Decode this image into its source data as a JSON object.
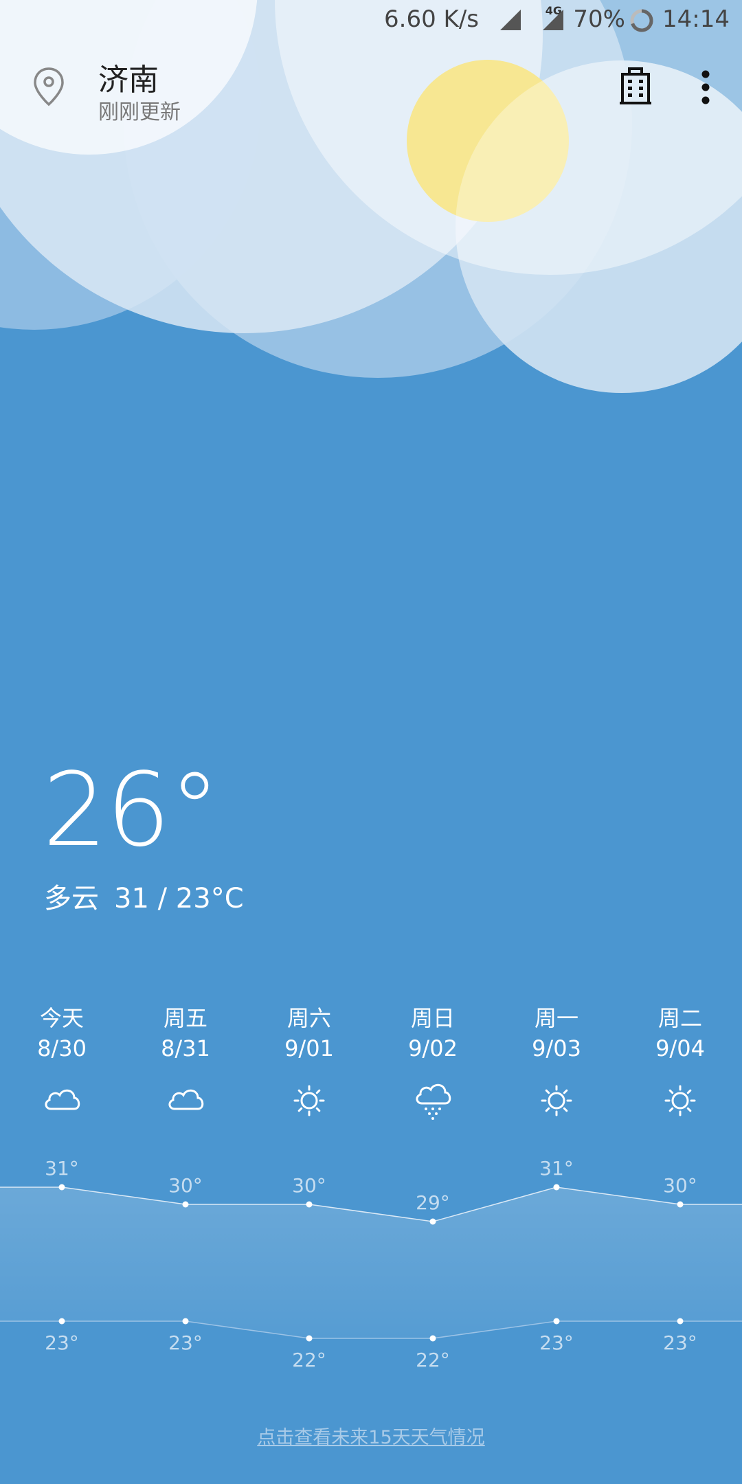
{
  "status_bar": {
    "net_speed": "6.60 K/s",
    "network_type": "4G",
    "battery": "70%",
    "time": "14:14"
  },
  "header": {
    "city": "济南",
    "updated": "刚刚更新"
  },
  "current": {
    "temperature": "26°",
    "condition": "多云",
    "range": "31 / 23°C"
  },
  "forecast": [
    {
      "day": "今天",
      "date": "8/30",
      "icon": "cloud-icon",
      "high": "31°",
      "low": "23°"
    },
    {
      "day": "周五",
      "date": "8/31",
      "icon": "cloud-icon",
      "high": "30°",
      "low": "23°"
    },
    {
      "day": "周六",
      "date": "9/01",
      "icon": "sun-icon",
      "high": "30°",
      "low": "22°"
    },
    {
      "day": "周日",
      "date": "9/02",
      "icon": "rain-snow-icon",
      "high": "29°",
      "low": "22°"
    },
    {
      "day": "周一",
      "date": "9/03",
      "icon": "sun-icon",
      "high": "31°",
      "low": "23°"
    },
    {
      "day": "周二",
      "date": "9/04",
      "icon": "sun-icon",
      "high": "30°",
      "low": "23°"
    }
  ],
  "chart_data": {
    "type": "line",
    "categories": [
      "8/30",
      "8/31",
      "9/01",
      "9/02",
      "9/03",
      "9/04"
    ],
    "series": [
      {
        "values": [
          31,
          30,
          30,
          29,
          31,
          30
        ]
      },
      {
        "values": [
          23,
          23,
          22,
          22,
          23,
          23
        ]
      }
    ]
  },
  "footer": {
    "link": "点击查看未来15天天气情况"
  },
  "colors": {
    "background": "#4b96d0",
    "sun": "#f0d43a"
  }
}
